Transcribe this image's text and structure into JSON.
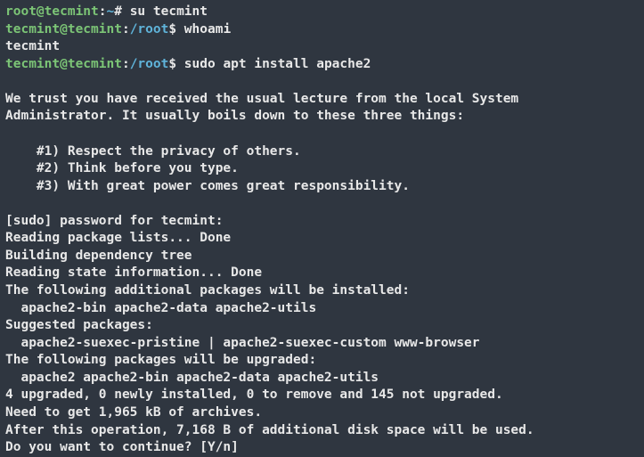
{
  "lines": {
    "l0_user": "root",
    "l0_at": "@",
    "l0_host": "tecmint",
    "l0_colon": ":",
    "l0_path": "~",
    "l0_sym": "#",
    "l0_cmd": " su tecmint",
    "l1_user": "tecmint",
    "l1_at": "@",
    "l1_host": "tecmint",
    "l1_colon": ":",
    "l1_path": "/root",
    "l1_sym": "$",
    "l1_cmd": " whoami",
    "l2": "tecmint",
    "l3_user": "tecmint",
    "l3_at": "@",
    "l3_host": "tecmint",
    "l3_colon": ":",
    "l3_path": "/root",
    "l3_sym": "$",
    "l3_cmd": " sudo apt install apache2",
    "l5": "We trust you have received the usual lecture from the local System",
    "l6": "Administrator. It usually boils down to these three things:",
    "l8": "    #1) Respect the privacy of others.",
    "l9": "    #2) Think before you type.",
    "l10": "    #3) With great power comes great responsibility.",
    "l12": "[sudo] password for tecmint:",
    "l13": "Reading package lists... Done",
    "l14": "Building dependency tree",
    "l15": "Reading state information... Done",
    "l16": "The following additional packages will be installed:",
    "l17": "  apache2-bin apache2-data apache2-utils",
    "l18": "Suggested packages:",
    "l19": "  apache2-suexec-pristine | apache2-suexec-custom www-browser",
    "l20": "The following packages will be upgraded:",
    "l21": "  apache2 apache2-bin apache2-data apache2-utils",
    "l22": "4 upgraded, 0 newly installed, 0 to remove and 145 not upgraded.",
    "l23": "Need to get 1,965 kB of archives.",
    "l24": "After this operation, 7,168 B of additional disk space will be used.",
    "l25": "Do you want to continue? [Y/n]"
  }
}
